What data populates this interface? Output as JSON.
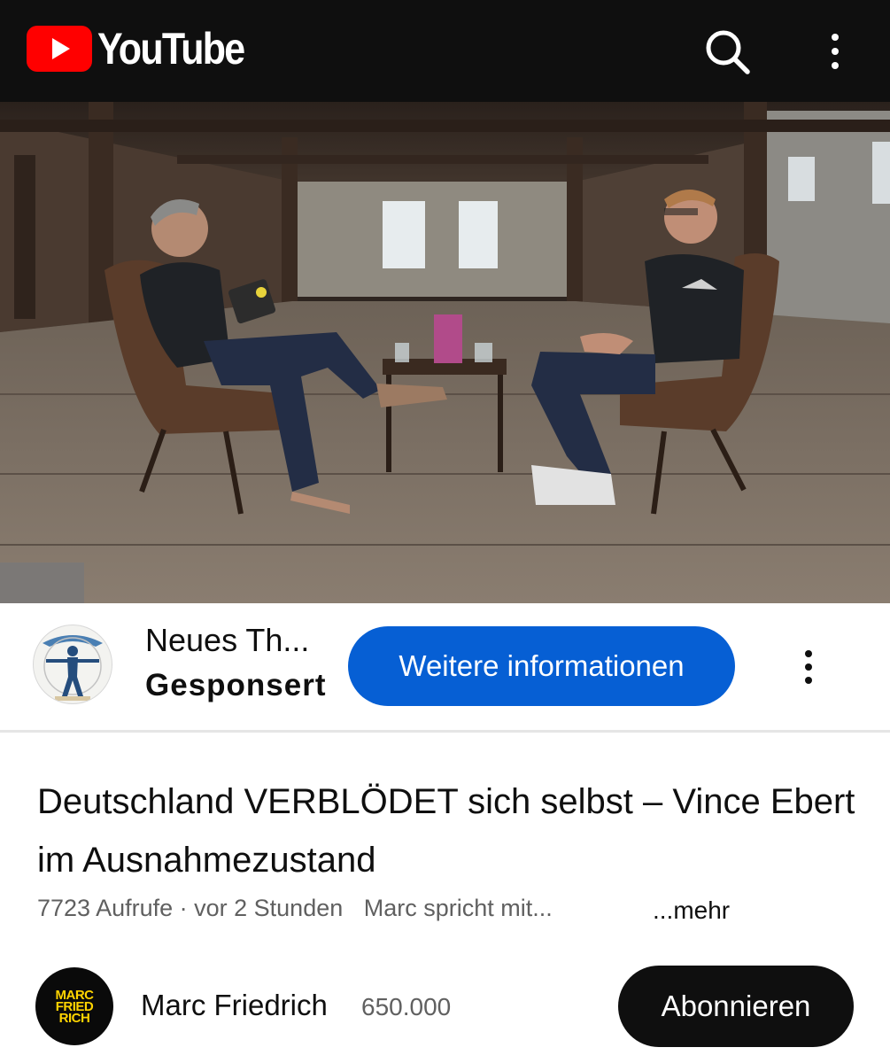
{
  "header": {
    "logo_text": "YouTube",
    "icons": {
      "search": "search-icon",
      "more": "more-vert-icon"
    },
    "colors": {
      "background": "#0f0f0f",
      "logo_red": "#ff0000"
    }
  },
  "ad": {
    "advertiser": "Neues Th...",
    "sponsored_label": "Gesponsert",
    "cta_label": "Weitere informationen",
    "cta_color": "#065fd4"
  },
  "video": {
    "title": "Deutschland VERBLÖDET sich selbst – Vince Ebert im Ausnahmezustand",
    "views_time": "7723 Aufrufe · vor 2 Stunden",
    "description_snippet": "Marc spricht mit...",
    "more_label": "...mehr"
  },
  "channel": {
    "name": "Marc Friedrich",
    "subscribers": "650.000",
    "avatar_lines": [
      "MARC",
      "FRIED",
      "RICH"
    ],
    "subscribe_label": "Abonnieren"
  }
}
